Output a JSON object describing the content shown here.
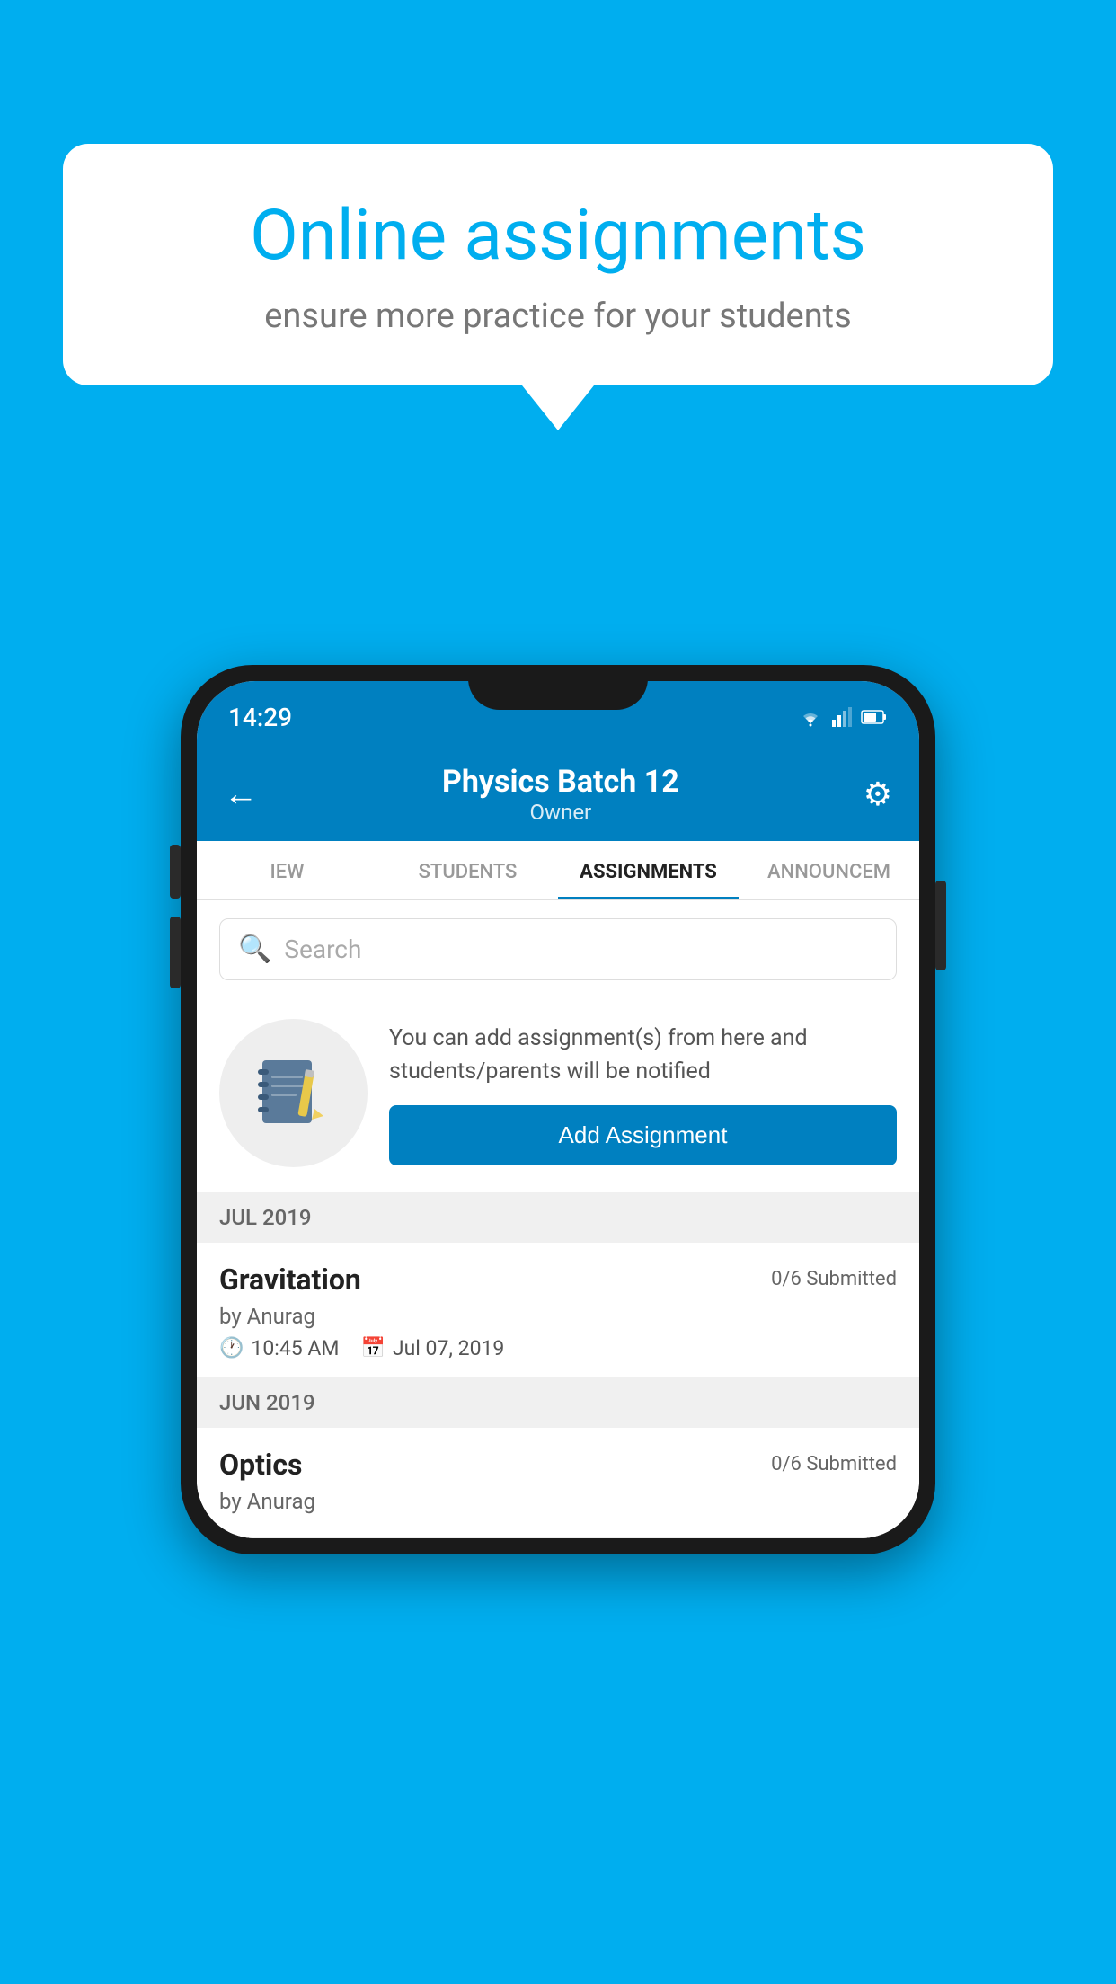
{
  "background": {
    "color": "#00AEEF"
  },
  "speech_bubble": {
    "title": "Online assignments",
    "subtitle": "ensure more practice for your students"
  },
  "phone": {
    "status_bar": {
      "time": "14:29",
      "icons": "wifi signal battery"
    },
    "header": {
      "title": "Physics Batch 12",
      "subtitle": "Owner",
      "back_label": "←",
      "gear_label": "⚙"
    },
    "tabs": [
      {
        "label": "IEW",
        "active": false
      },
      {
        "label": "STUDENTS",
        "active": false
      },
      {
        "label": "ASSIGNMENTS",
        "active": true
      },
      {
        "label": "ANNOUNCEM",
        "active": false
      }
    ],
    "search": {
      "placeholder": "Search"
    },
    "info_card": {
      "text": "You can add assignment(s) from here and students/parents will be notified",
      "button_label": "Add Assignment"
    },
    "sections": [
      {
        "label": "JUL 2019",
        "assignments": [
          {
            "name": "Gravitation",
            "submitted": "0/6 Submitted",
            "by": "by Anurag",
            "time": "10:45 AM",
            "date": "Jul 07, 2019"
          }
        ]
      },
      {
        "label": "JUN 2019",
        "assignments": [
          {
            "name": "Optics",
            "submitted": "0/6 Submitted",
            "by": "by Anurag",
            "time": "",
            "date": ""
          }
        ]
      }
    ]
  }
}
